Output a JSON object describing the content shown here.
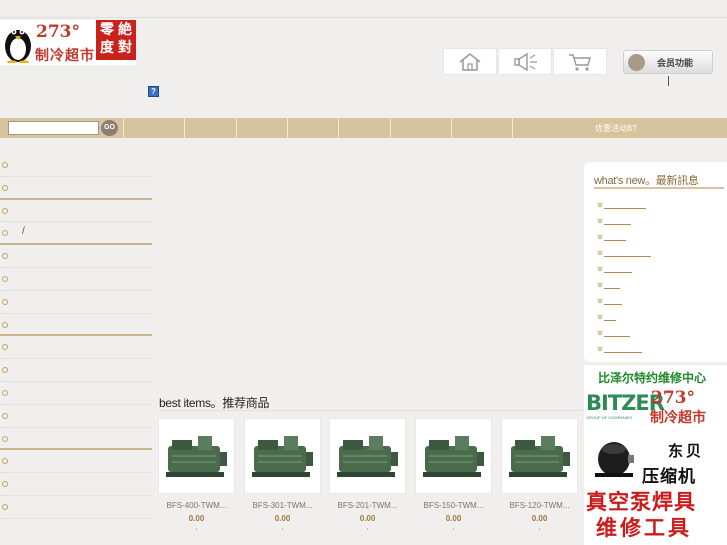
{
  "logo": {
    "number": "273°",
    "tagline": "制冷超市",
    "seal_chars": [
      "零",
      "絶",
      "度",
      "對"
    ]
  },
  "header": {
    "member_label": "会员功能",
    "help_glyph": "?"
  },
  "nav": {
    "search_value": "",
    "go_label": "GO",
    "promo_label": "优惠活动BT"
  },
  "sidebar": {
    "items": [
      "",
      "",
      "",
      "/",
      "",
      "",
      "",
      "",
      "",
      "",
      "",
      "",
      "",
      "",
      "",
      ""
    ]
  },
  "best": {
    "title": "best items。推荐商品",
    "products": [
      {
        "name": "BFS-400-TWM...",
        "price": "0.00",
        "mark": ","
      },
      {
        "name": "BFS-301-TWM...",
        "price": "0.00",
        "mark": ","
      },
      {
        "name": "BFS-201-TWM...",
        "price": "0.00",
        "mark": ","
      },
      {
        "name": "BFS-150-TWM...",
        "price": "0.00",
        "mark": ","
      },
      {
        "name": "BFS-120-TWM...",
        "price": "0.00",
        "mark": ","
      }
    ]
  },
  "news": {
    "title": "what's new。最新訊息"
  },
  "ad": {
    "line1": "比泽尔特约维修中心",
    "brand": "BITZER",
    "brand_sub": "GROUP OF COMPANIES",
    "number": "273°",
    "tagline": "制冷超市",
    "dongbei": "东贝",
    "compressor": "压缩机",
    "vacuum": "真空泵焊具",
    "tools": "维修工具"
  },
  "colors": {
    "page_bg": "#f0efed",
    "nav_bg": "#d7c39c",
    "brand_red": "#c0392b",
    "bitzer_green": "#2e8b57"
  }
}
